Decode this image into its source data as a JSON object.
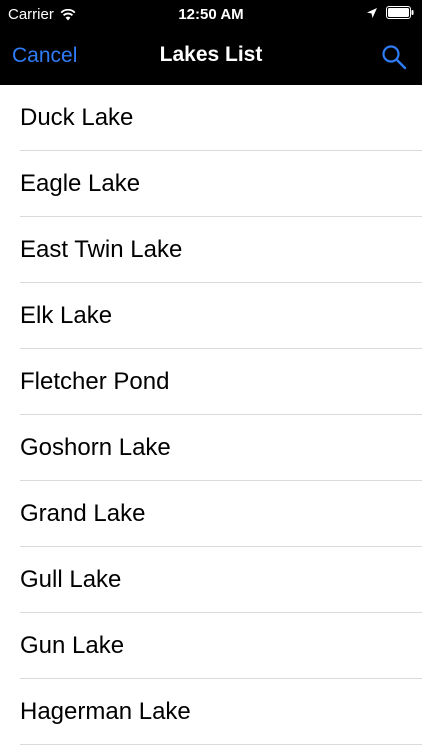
{
  "status_bar": {
    "carrier": "Carrier",
    "time": "12:50 AM"
  },
  "nav": {
    "cancel_label": "Cancel",
    "title": "Lakes List",
    "search_icon": "search-icon"
  },
  "colors": {
    "accent": "#2f7cf6",
    "nav_background": "#000000",
    "list_background": "#ffffff",
    "separator": "#d9d9de"
  },
  "lakes": [
    "Duck Lake",
    "Eagle Lake",
    "East Twin Lake",
    "Elk Lake",
    "Fletcher Pond",
    "Goshorn Lake",
    "Grand Lake",
    "Gull Lake",
    "Gun Lake",
    "Hagerman Lake"
  ]
}
